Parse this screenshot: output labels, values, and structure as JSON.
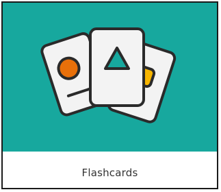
{
  "tile": {
    "label": "Flashcards",
    "icon": "flashcards-icon"
  },
  "colors": {
    "background": "#17a89e",
    "card_fill": "#f3f3f3",
    "card_stroke": "#2a2a2a",
    "circle": "#e8700a",
    "triangle": "#17a89e",
    "square": "#f7b500"
  }
}
